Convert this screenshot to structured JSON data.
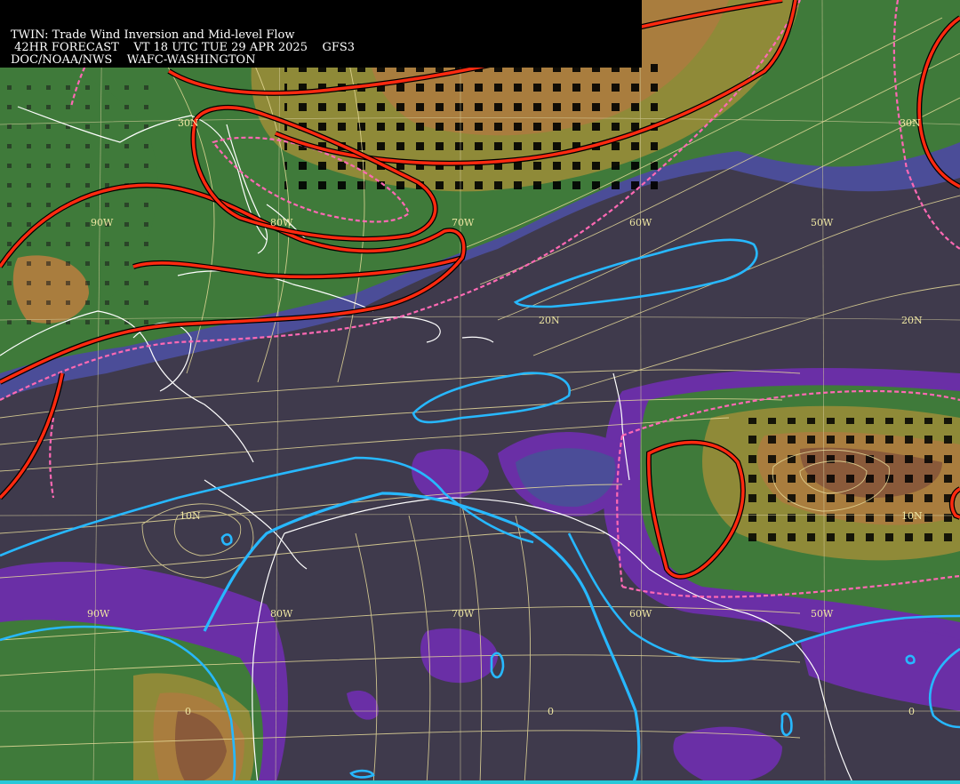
{
  "header": {
    "line1": "TWIN: Trade Wind Inversion and Mid-level Flow",
    "line2": " 42HR FORECAST    VT 18 UTC TUE 29 APR 2025    GFS3",
    "line3": "DOC/NOAA/NWS    WAFC-WASHINGTON"
  },
  "grid_labels": {
    "lon_90w_top": "90W",
    "lon_80w_top": "80W",
    "lon_70w_top": "70W",
    "lon_60w_top": "60W",
    "lon_50w_top": "50W",
    "lat_30n_left": "30N",
    "lat_30n_right": "30N",
    "lat_20n_mid": "20N",
    "lat_20n_right": "20N",
    "lat_10n_left": "10N",
    "lat_10n_right": "10N",
    "lon_90w_bottom": "90W",
    "lon_80w_bottom": "80W",
    "lon_70w_bottom": "70W",
    "lon_60w_bottom": "60W",
    "lon_50w_bottom": "50W",
    "lat_0_left": "0",
    "lat_0_mid": "0",
    "lat_0_right": "0"
  },
  "colors": {
    "background": "#3f3a4c",
    "purple": "#6a2fa6",
    "blue_band": "#4b4d98",
    "green": "#3f7a3a",
    "dark_green": "#2f6a30",
    "olive": "#8f8a38",
    "tan": "#a97d3e",
    "brown": "#8a5a3a",
    "red_contour": "#ff2a10",
    "pink_dashed": "#ff69b4",
    "cyan_contour": "#27b8ff",
    "streamline": "#e8dc9a",
    "coastline": "#ffffff",
    "grid": "#d8d0a0"
  }
}
